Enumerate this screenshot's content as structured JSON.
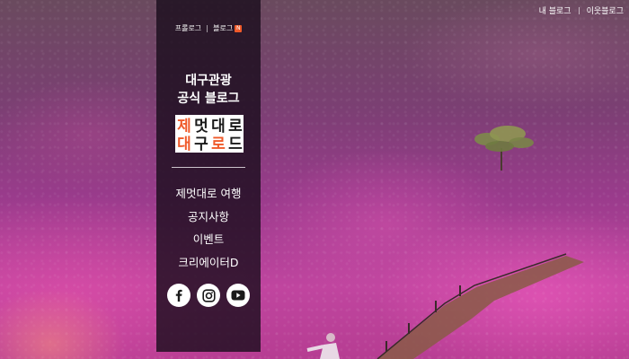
{
  "top_links": {
    "my_blog": "내 블로그",
    "neighbor_blog": "이웃블로그"
  },
  "panel": {
    "links": {
      "prologue": "프롤로그",
      "blog": "블로그",
      "new_badge": "N"
    },
    "title_line1": "대구관광",
    "title_line2": "공식 블로그",
    "logo": {
      "row1": [
        "제",
        "멋",
        "대",
        "로"
      ],
      "row2": [
        "대",
        "구",
        "로",
        "드"
      ],
      "accent_color": "#f05a2a"
    },
    "menu": [
      {
        "label": "제멋대로 여행"
      },
      {
        "label": "공지사항"
      },
      {
        "label": "이벤트"
      },
      {
        "label": "크리에이터D"
      }
    ],
    "social": [
      {
        "icon": "facebook-icon"
      },
      {
        "icon": "instagram-icon"
      },
      {
        "icon": "youtube-icon"
      }
    ]
  }
}
